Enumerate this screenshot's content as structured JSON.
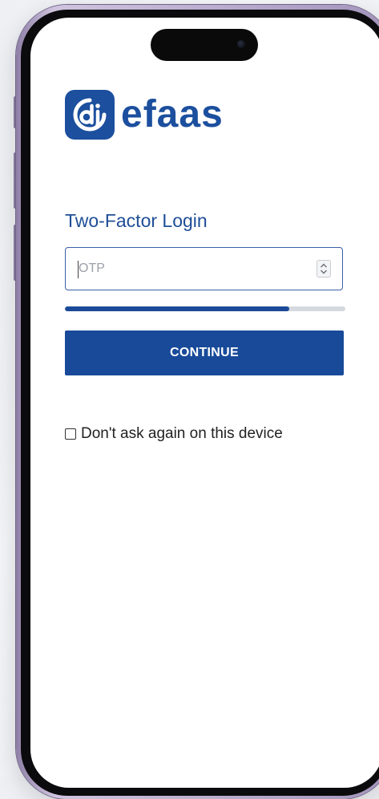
{
  "brand": {
    "name": "efaas",
    "logo_icon": "efaas-logo-icon",
    "color": "#1c4f9e"
  },
  "login": {
    "title": "Two-Factor Login",
    "otp_placeholder": "OTP",
    "otp_value": "",
    "continue_label": "CONTINUE",
    "progress": 0.8,
    "remember_label": "Don't ask again on this device",
    "remember_checked": false
  }
}
